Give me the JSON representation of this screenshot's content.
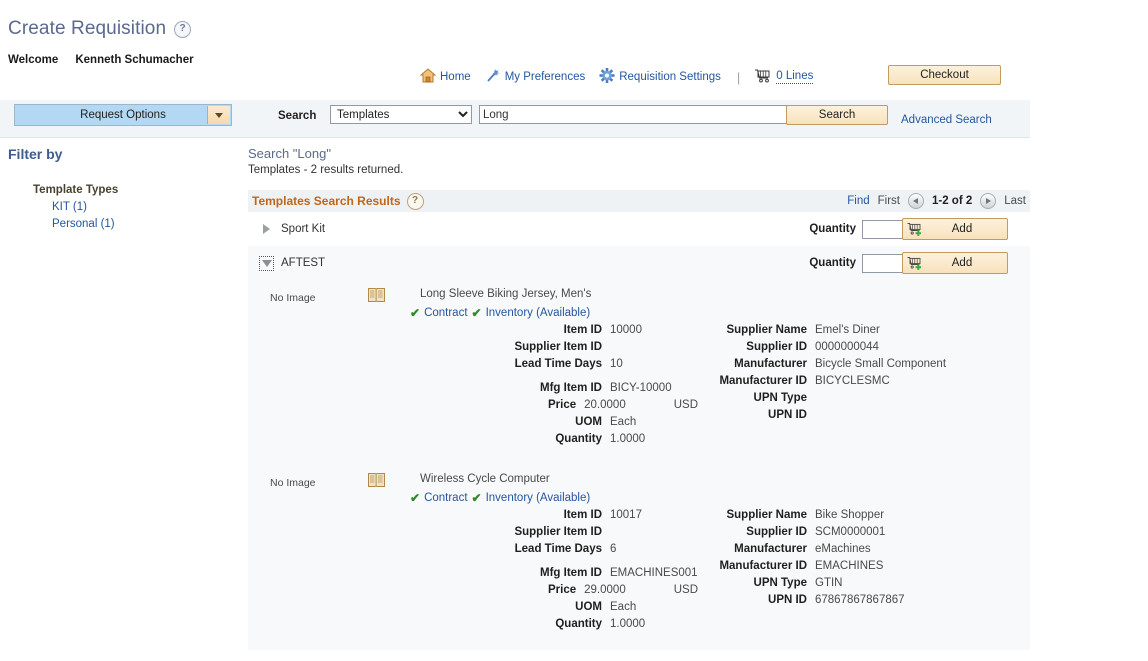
{
  "header": {
    "title": "Create Requisition",
    "help_icon": "help-icon",
    "welcome_label": "Welcome",
    "user_name": "Kenneth Schumacher"
  },
  "topnav": {
    "items": [
      {
        "label": "Home",
        "icon": "home-icon"
      },
      {
        "label": "My Preferences",
        "icon": "wand-icon"
      },
      {
        "label": "Requisition Settings",
        "icon": "gear-icon"
      }
    ],
    "separator": "|",
    "cart": {
      "icon": "shopping-cart-icon",
      "label": "0 Lines"
    },
    "checkout_label": "Checkout"
  },
  "toolbar": {
    "request_options_label": "Request Options",
    "search_label": "Search",
    "search_type_selected": "Templates",
    "search_type_options": [
      "Templates"
    ],
    "search_value": "Long",
    "search_placeholder": "",
    "search_button_label": "Search",
    "advanced_search_label": "Advanced Search"
  },
  "filter": {
    "title": "Filter by",
    "group_title": "Template Types",
    "links": [
      {
        "label": "KIT (1)"
      },
      {
        "label": "Personal (1)"
      }
    ]
  },
  "results": {
    "heading": "Search \"Long\"",
    "subheading": "Templates - 2 results returned.",
    "grid_title": "Templates Search Results",
    "grid_help_icon": "help-icon",
    "nav": {
      "find": "Find",
      "first": "First",
      "range": "1-2 of 2",
      "last": "Last",
      "prev_icon": "prev-arrow-icon",
      "next_icon": "next-arrow-icon"
    },
    "quantity_label": "Quantity",
    "add_label": "Add",
    "add_icon": "cart-add-icon",
    "templates": [
      {
        "name": "Sport Kit",
        "expanded": false,
        "quantity_value": "",
        "toggle_icon": "chevron-right-icon"
      },
      {
        "name": "AFTEST",
        "expanded": true,
        "quantity_value": "",
        "toggle_icon": "chevron-down-icon"
      }
    ],
    "items": [
      {
        "no_image_label": "No Image",
        "catalog_icon": "book-icon",
        "name": "Long Sleeve Biking Jersey, Men's",
        "badges": [
          {
            "label": "Contract",
            "check": "✔"
          },
          {
            "label": "Inventory (Available)",
            "check": "✔"
          }
        ],
        "left_fields": [
          {
            "key": "Item ID",
            "value": "10000"
          },
          {
            "key": "Supplier Item ID",
            "value": ""
          },
          {
            "key": "Lead Time Days",
            "value": "10"
          },
          {
            "key": "Mfg Item ID",
            "value": "BICY-10000"
          },
          {
            "key": "Price",
            "value": "20.0000",
            "currency": "USD"
          },
          {
            "key": "UOM",
            "value": "Each"
          },
          {
            "key": "Quantity",
            "value": "1.0000"
          }
        ],
        "right_fields": [
          {
            "key": "Supplier Name",
            "value": "Emel's Diner"
          },
          {
            "key": "Supplier ID",
            "value": "0000000044"
          },
          {
            "key": "Manufacturer",
            "value": "Bicycle Small Component"
          },
          {
            "key": "Manufacturer ID",
            "value": "BICYCLESMC"
          },
          {
            "key": "UPN Type",
            "value": ""
          },
          {
            "key": "UPN ID",
            "value": ""
          }
        ]
      },
      {
        "no_image_label": "No Image",
        "catalog_icon": "book-icon",
        "name": "Wireless Cycle Computer",
        "badges": [
          {
            "label": "Contract",
            "check": "✔"
          },
          {
            "label": "Inventory (Available)",
            "check": "✔"
          }
        ],
        "left_fields": [
          {
            "key": "Item ID",
            "value": "10017"
          },
          {
            "key": "Supplier Item ID",
            "value": ""
          },
          {
            "key": "Lead Time Days",
            "value": "6"
          },
          {
            "key": "Mfg Item ID",
            "value": "EMACHINES001"
          },
          {
            "key": "Price",
            "value": "29.0000",
            "currency": "USD"
          },
          {
            "key": "UOM",
            "value": "Each"
          },
          {
            "key": "Quantity",
            "value": "1.0000"
          }
        ],
        "right_fields": [
          {
            "key": "Supplier Name",
            "value": "Bike Shopper"
          },
          {
            "key": "Supplier ID",
            "value": "SCM0000001"
          },
          {
            "key": "Manufacturer",
            "value": "eMachines"
          },
          {
            "key": "Manufacturer ID",
            "value": "EMACHINES"
          },
          {
            "key": "UPN Type",
            "value": "GTIN"
          },
          {
            "key": "UPN ID",
            "value": "67867867867867"
          }
        ]
      }
    ]
  },
  "colors": {
    "title_blue": "#5a6a8c",
    "link_blue": "#25569e",
    "grid_orange": "#c1651b",
    "button_tan": "#f8e2bd",
    "request_options_blue": "#b2d8f4",
    "check_green": "#2e8b28"
  }
}
